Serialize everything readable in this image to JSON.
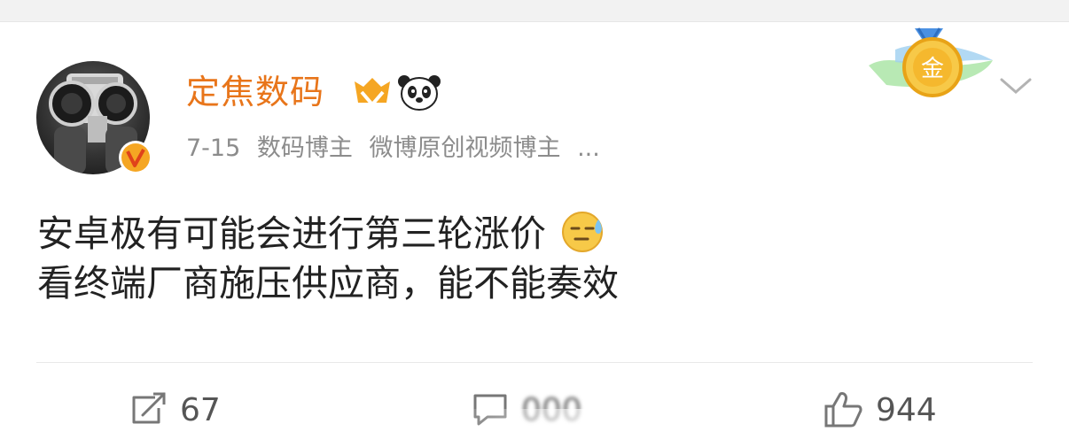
{
  "author": {
    "name": "定焦数码",
    "date": "7-15",
    "tag1": "数码博主",
    "tag2": "微博原创视频博主",
    "more": "..."
  },
  "post": {
    "line1": "安卓极有可能会进行第三轮涨价",
    "line2": "看终端厂商施压供应商，能不能奏效"
  },
  "actions": {
    "repost_count": "67",
    "comment_count": "000",
    "like_count": "944"
  },
  "colors": {
    "username": "#e8751a",
    "meta": "#8c8c8c",
    "text": "#222222",
    "action": "#555555"
  },
  "icons": [
    "verified-badge-icon",
    "crown-badge-icon",
    "panda-icon",
    "gold-medal-icon",
    "chevron-down-icon",
    "repost-icon",
    "comment-icon",
    "like-icon",
    "sweat-emoji-icon"
  ]
}
